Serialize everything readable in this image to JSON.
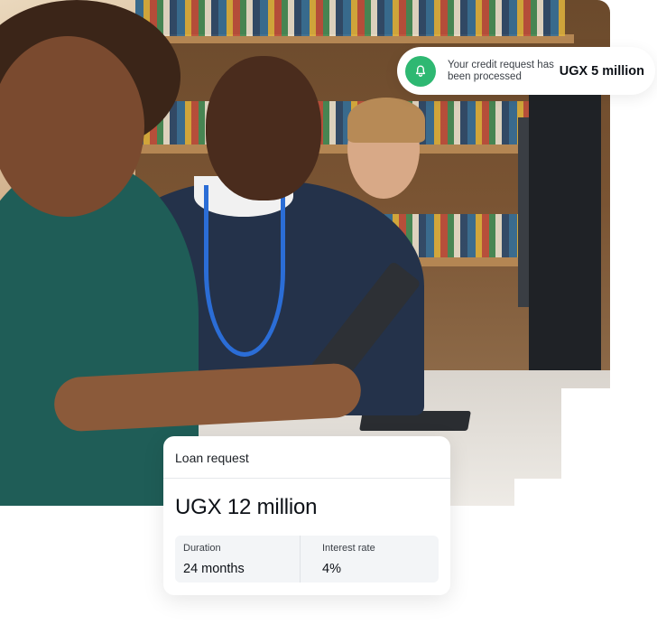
{
  "notification": {
    "message": "Your credit request has been processed",
    "amount": "UGX 5 million",
    "icon": "bell-icon",
    "icon_color": "#2eb872"
  },
  "loan_card": {
    "title": "Loan request",
    "amount": "UGX 12 million",
    "details": [
      {
        "label": "Duration",
        "value": "24 months"
      },
      {
        "label": "Interest rate",
        "value": "4%"
      }
    ]
  },
  "photo": {
    "subject": "photo-library-students-tablet"
  }
}
